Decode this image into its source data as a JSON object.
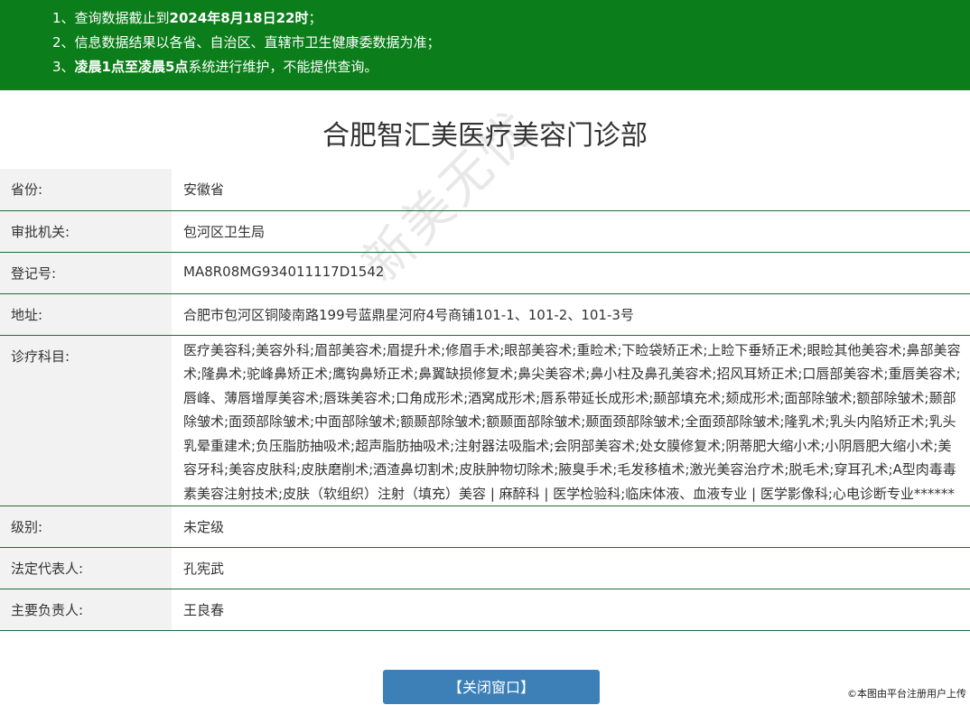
{
  "notice": {
    "line1_a": "1、查询数据截止到",
    "line1_b": "2024年8月18日22时",
    "line1_c": "；",
    "line2": "2、信息数据结果以各省、自治区、直辖市卫生健康委数据为准；",
    "line3_a": "3、",
    "line3_b": "凌晨1点至凌晨5点",
    "line3_c": "系统进行维护，不能提供查询。"
  },
  "title": "合肥智汇美医疗美容门诊部",
  "rows": [
    {
      "label": "省份:",
      "value": "安徽省"
    },
    {
      "label": "审批机关:",
      "value": "包河区卫生局"
    },
    {
      "label": "登记号:",
      "value": "MA8R08MG934011117D1542"
    },
    {
      "label": "地址:",
      "value": "合肥市包河区铜陵南路199号蓝鼎星河府4号商铺101-1、101-2、101-3号"
    },
    {
      "label": "诊疗科目:",
      "value": "医疗美容科;美容外科;眉部美容术;眉提升术;修眉手术;眼部美容术;重睑术;下睑袋矫正术;上睑下垂矫正术;眼睑其他美容术;鼻部美容术;隆鼻术;驼峰鼻矫正术;鹰钩鼻矫正术;鼻翼缺损修复术;鼻尖美容术;鼻小柱及鼻孔美容术;招风耳矫正术;口唇部美容术;重唇美容术;唇峰、薄唇增厚美容术;唇珠美容术;口角成形术;酒窝成形术;唇系带延长成形术;颞部填充术;颏成形术;面部除皱术;额部除皱术;颞部除皱术;面颈部除皱术;中面部除皱术;额颞部除皱术;额颞面部除皱术;颞面颈部除皱术;全面颈部除皱术;隆乳术;乳头内陷矫正术;乳头乳晕重建术;负压脂肪抽吸术;超声脂肪抽吸术;注射器法吸脂术;会阴部美容术;处女膜修复术;阴蒂肥大缩小术;小阴唇肥大缩小术;美容牙科;美容皮肤科;皮肤磨削术;酒渣鼻切割术;皮肤肿物切除术;腋臭手术;毛发移植术;激光美容治疗术;脱毛术;穿耳孔术;A型肉毒毒素美容注射技术;皮肤（软组织）注射（填充）美容 | 麻醉科 | 医学检验科;临床体液、血液专业 | 医学影像科;心电诊断专业******"
    },
    {
      "label": "级别:",
      "value": "未定级"
    },
    {
      "label": "法定代表人:",
      "value": "孔宪武"
    },
    {
      "label": "主要负责人:",
      "value": "王良春"
    }
  ],
  "watermark": "新美无忧",
  "close_button": "【关闭窗口】",
  "credit": "©本图由平台注册用户上传",
  "colors": {
    "notice_bg": "#0b7d1a",
    "button_bg": "#3d80b8",
    "label_bg": "#f2f2f2",
    "row_border": "#1f6b3a"
  }
}
